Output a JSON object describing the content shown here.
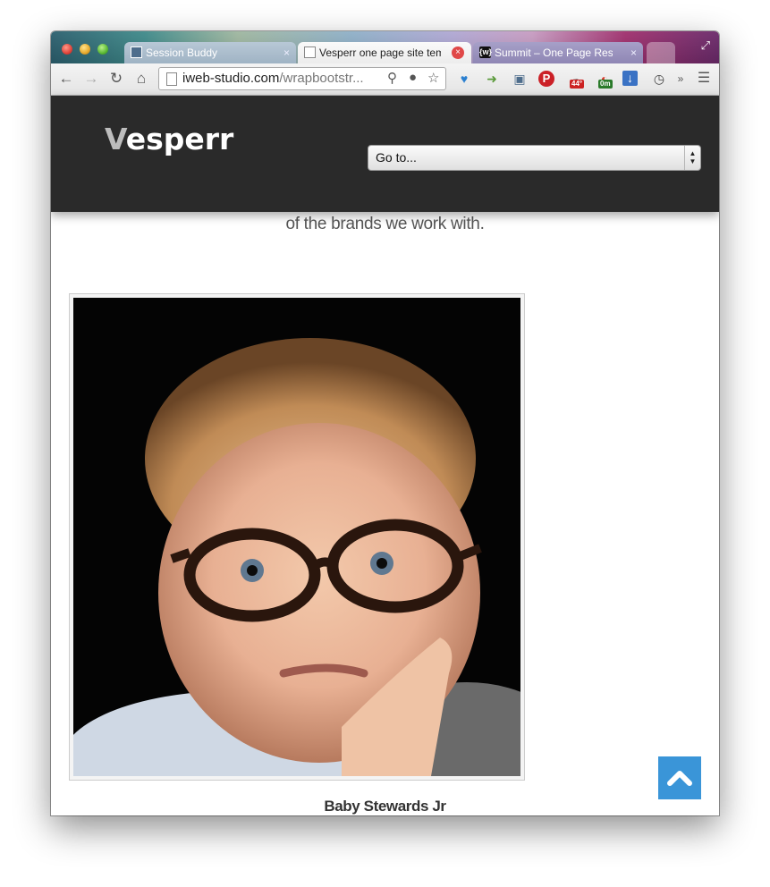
{
  "browser": {
    "tabs": [
      {
        "title": "Session Buddy",
        "active": false
      },
      {
        "title": "Vesperr one page site template",
        "active": true
      },
      {
        "title": "Summit – One Page Responsive",
        "active": false
      }
    ],
    "favicon_summit": "{w}",
    "close_glyph": "×",
    "expand_glyph": "⤢",
    "url_main": "iweb-studio.com",
    "url_path": "/wrapbootstr...",
    "extension_badges": {
      "weather": "44°",
      "timer": "0m"
    },
    "icons": [
      "back-icon",
      "forward-icon",
      "reload-icon",
      "home-icon",
      "page-icon",
      "search-zoom-icon",
      "lightbulb-icon",
      "star-icon",
      "heart-filter-icon",
      "send-icon",
      "session-icon",
      "pinterest-icon",
      "weather-icon",
      "timer-icon",
      "download-icon",
      "clock-icon",
      "overflow-icon",
      "menu-icon"
    ]
  },
  "site": {
    "logo": {
      "v": "V",
      "rest": "esperr"
    },
    "nav_select": {
      "label": "Go to..."
    },
    "intro_text": "of the brands we work with.",
    "portfolio": {
      "caption": "Baby Stewards Jr"
    },
    "accent": "#3a95d8",
    "header_bg": "#2a2a2a"
  }
}
